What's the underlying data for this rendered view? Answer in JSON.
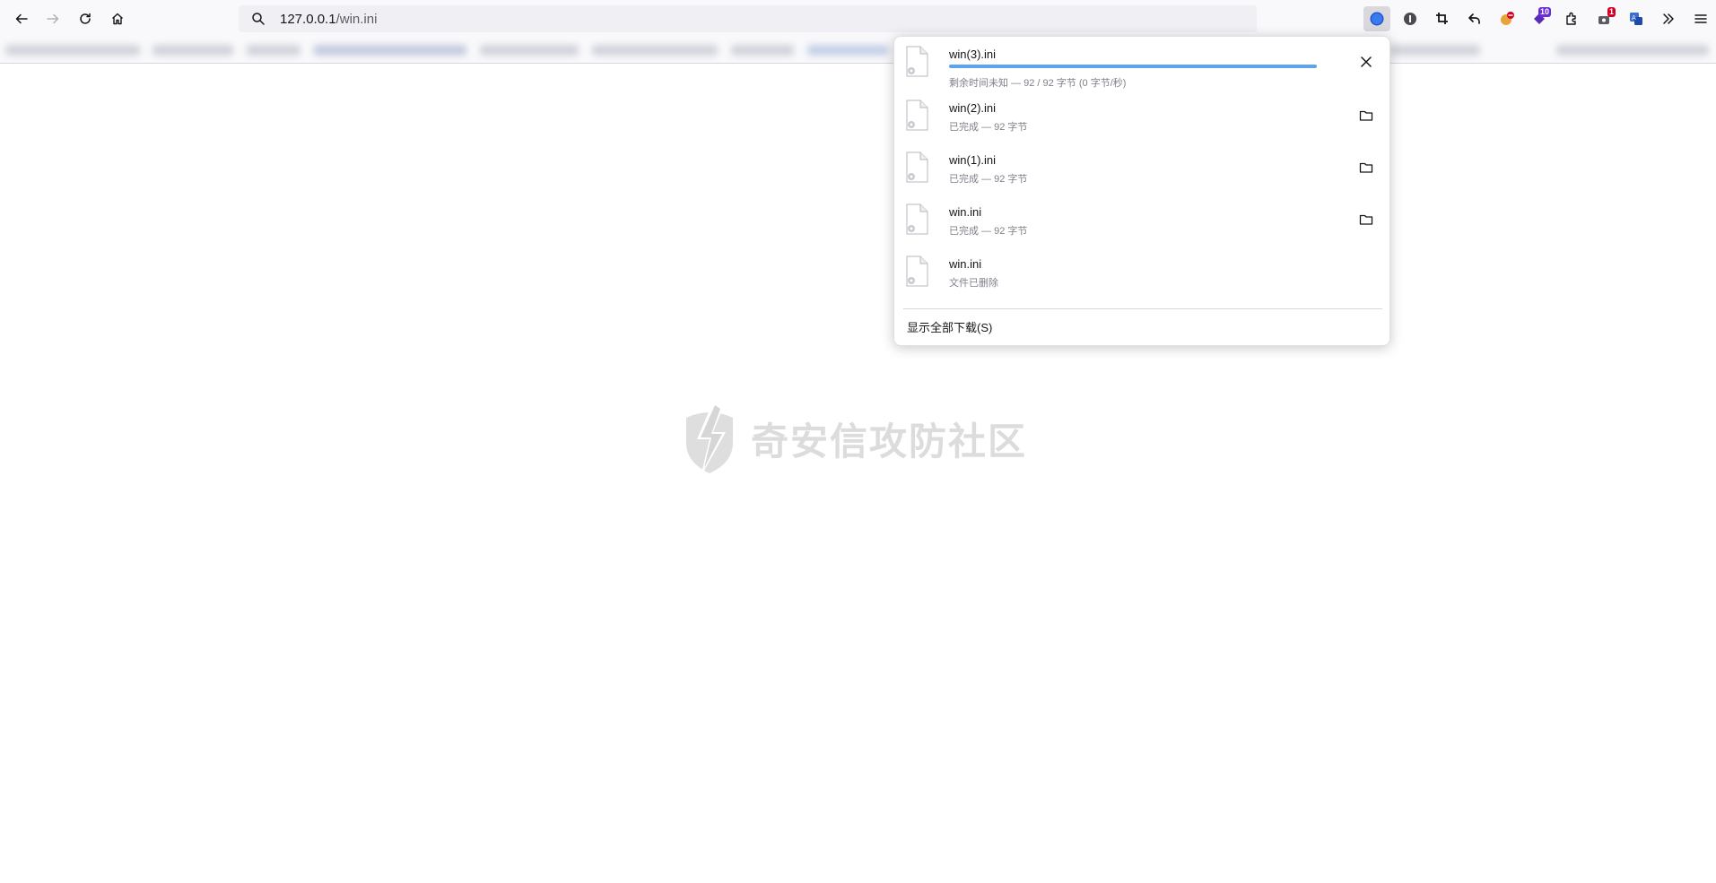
{
  "toolbar": {
    "url_host": "127.0.0.1",
    "url_path": "/win.ini",
    "badges": {
      "extension_a": "10",
      "extension_b": "1"
    },
    "colors": {
      "badge_purple": "#6a2bd8",
      "badge_red": "#d70022"
    }
  },
  "downloads": {
    "items": [
      {
        "name": "win(3).ini",
        "status": "剩余时间未知 — 92 / 92 字节 (0 字节/秒)",
        "progress": 1.0,
        "action": "cancel-icon"
      },
      {
        "name": "win(2).ini",
        "status": "已完成 — 92 字节",
        "action": "folder-icon"
      },
      {
        "name": "win(1).ini",
        "status": "已完成 — 92 字节",
        "action": "folder-icon"
      },
      {
        "name": "win.ini",
        "status": "已完成 — 92 字节",
        "action": "folder-icon"
      },
      {
        "name": "win.ini",
        "status": "文件已删除",
        "action": ""
      }
    ],
    "show_all_label": "显示全部下载(S)"
  },
  "watermark": {
    "text": "奇安信攻防社区"
  }
}
